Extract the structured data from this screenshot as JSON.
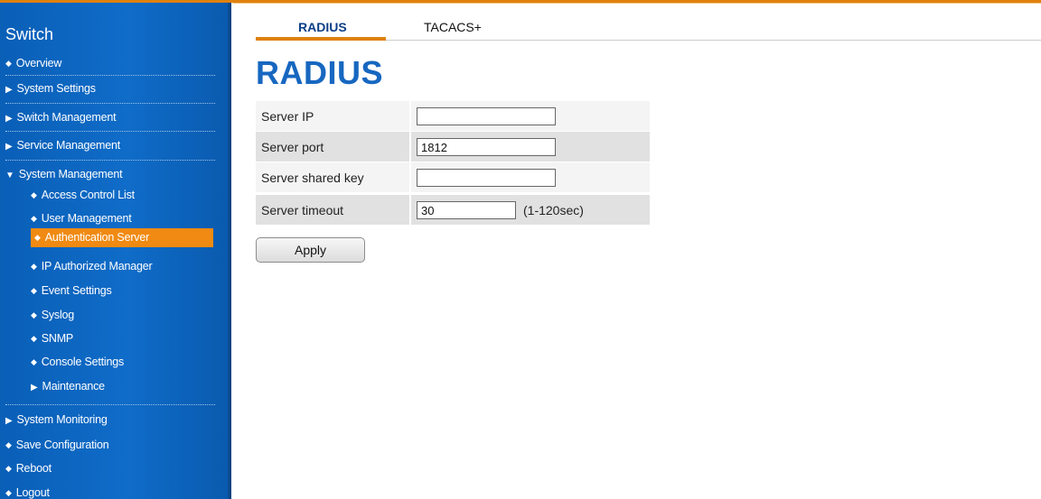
{
  "colors": {
    "accent": "#e0810e",
    "sidebar": "#0f6cc8",
    "active_item": "#f08a12",
    "title": "#1767c0"
  },
  "sidebar": {
    "title": "Switch",
    "overview": "Overview",
    "system_settings": "System Settings",
    "switch_management": "Switch Management",
    "service_management": "Service Management",
    "system_management": "System Management",
    "sub_items": {
      "acl": "Access Control List",
      "user_management": "User Management",
      "auth_server": "Authentication Server",
      "ip_authorized": "IP Authorized Manager",
      "event_settings": "Event Settings",
      "syslog": "Syslog",
      "snmp": "SNMP",
      "console_settings": "Console Settings",
      "maintenance": "Maintenance"
    },
    "system_monitoring": "System Monitoring",
    "save_configuration": "Save Configuration",
    "reboot": "Reboot",
    "logout": "Logout"
  },
  "tabs": {
    "radius": "RADIUS",
    "tacacs": "TACACS+"
  },
  "page": {
    "title": "RADIUS"
  },
  "form": {
    "server_ip": {
      "label": "Server IP",
      "value": ""
    },
    "server_port": {
      "label": "Server port",
      "value": "1812"
    },
    "shared_key": {
      "label": "Server shared key",
      "value": ""
    },
    "timeout": {
      "label": "Server timeout",
      "value": "30",
      "hint": "(1-120sec)"
    },
    "apply_label": "Apply"
  }
}
